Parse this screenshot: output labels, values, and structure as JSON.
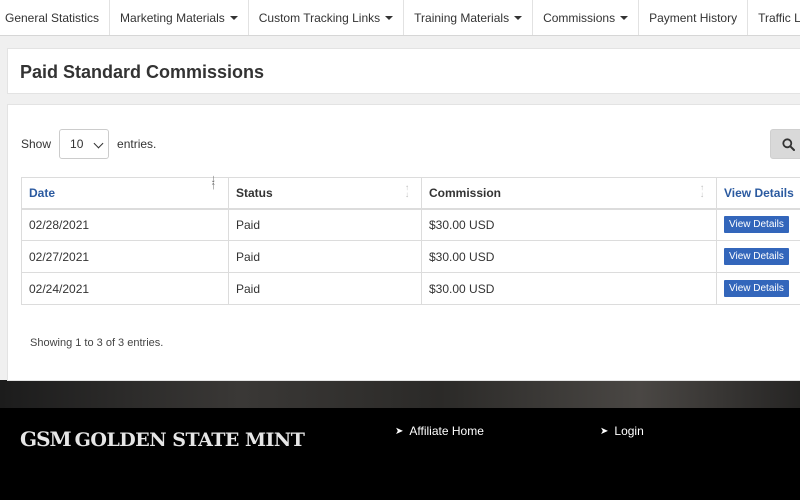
{
  "nav": {
    "items": [
      {
        "label": "General Statistics",
        "dropdown": false
      },
      {
        "label": "Marketing Materials",
        "dropdown": true
      },
      {
        "label": "Custom Tracking Links",
        "dropdown": true
      },
      {
        "label": "Training Materials",
        "dropdown": true
      },
      {
        "label": "Commissions",
        "dropdown": true
      },
      {
        "label": "Payment History",
        "dropdown": false
      },
      {
        "label": "Traffic Log",
        "dropdown": false
      }
    ]
  },
  "page": {
    "title": "Paid Standard Commissions"
  },
  "length_control": {
    "prefix": "Show",
    "value": "10",
    "suffix": "entries."
  },
  "table": {
    "headers": {
      "date": "Date",
      "status": "Status",
      "commission": "Commission",
      "details": "View Details"
    },
    "rows": [
      {
        "date": "02/28/2021",
        "status": "Paid",
        "commission": "$30.00 USD",
        "action": "View Details"
      },
      {
        "date": "02/27/2021",
        "status": "Paid",
        "commission": "$30.00 USD",
        "action": "View Details"
      },
      {
        "date": "02/24/2021",
        "status": "Paid",
        "commission": "$30.00 USD",
        "action": "View Details"
      }
    ],
    "info": "Showing 1 to 3 of 3 entries."
  },
  "footer": {
    "logo_mark": "GSM",
    "logo_text": "GOLDEN STATE MINT",
    "links": [
      {
        "label": "Affiliate Home"
      },
      {
        "label": "Login"
      }
    ]
  },
  "colors": {
    "link_blue": "#2b5aa0",
    "button_blue": "#3366bb",
    "footer_bg": "#000000"
  },
  "icons": {
    "search": "search-icon",
    "caret": "caret-down-icon",
    "footer_arrow": "arrow-right-icon"
  }
}
